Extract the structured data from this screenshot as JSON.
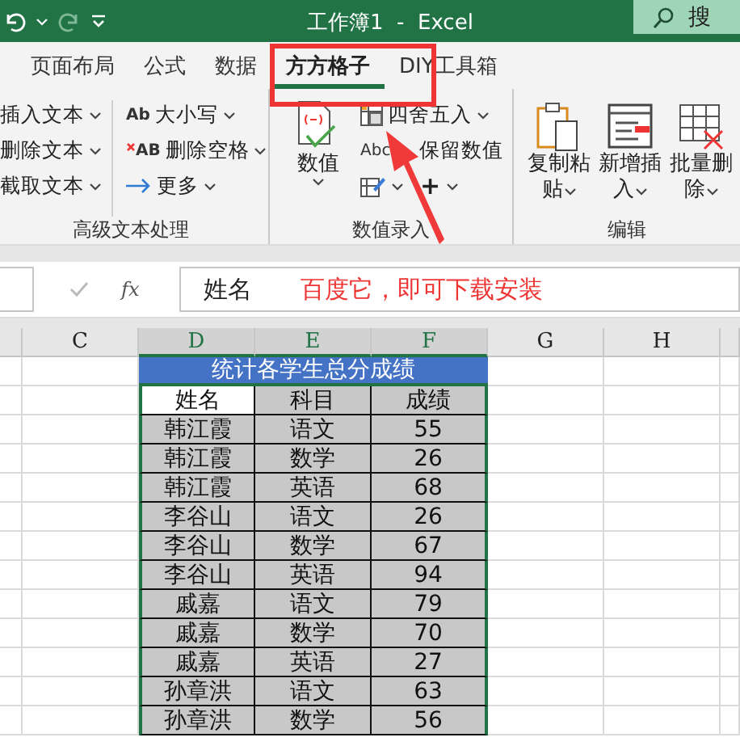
{
  "title_bar": {
    "title": "工作簿1  -  Excel",
    "search": "搜"
  },
  "tabs": [
    {
      "label": "页面布局",
      "selected": false
    },
    {
      "label": "公式",
      "selected": false
    },
    {
      "label": "数据",
      "selected": false
    },
    {
      "label": "方方格子",
      "selected": true
    },
    {
      "label": "DIY工具箱",
      "selected": false
    }
  ],
  "ribbon": {
    "groups": [
      {
        "label": "高级文本处理",
        "items": [
          {
            "label": "插入文本"
          },
          {
            "label": "删除文本"
          },
          {
            "label": "截取文本"
          }
        ],
        "items_2": [
          {
            "icon_text": "Ab",
            "label": "大小写"
          },
          {
            "icon_text": "AB",
            "label": "删除空格"
          },
          {
            "label": "更多"
          }
        ]
      },
      {
        "label": "数值录入",
        "big": {
          "label": "数值"
        },
        "items": [
          {
            "label": "四舍五入"
          },
          {
            "icon_text": "Abc",
            "label": "保留数值"
          },
          {
            "icon_text": "+"
          }
        ]
      },
      {
        "label": "编辑",
        "items": [
          {
            "label": "复制粘贴"
          },
          {
            "label": "新增插入"
          },
          {
            "label": "批量删除"
          }
        ]
      }
    ]
  },
  "formula_bar": {
    "function_symbol": "fx",
    "value": "姓名"
  },
  "annotation": {
    "note": "百度它，即可下载安装"
  },
  "sheet": {
    "columns": [
      {
        "label": "C",
        "selected": false
      },
      {
        "label": "D",
        "selected": true
      },
      {
        "label": "E",
        "selected": true
      },
      {
        "label": "F",
        "selected": true
      },
      {
        "label": "G",
        "selected": false
      },
      {
        "label": "H",
        "selected": false
      }
    ],
    "title": "统计各学生总分成绩",
    "header": {
      "D": "姓名",
      "E": "科目",
      "F": "成绩"
    },
    "rows": [
      {
        "D": "韩江霞",
        "E": "语文",
        "F": "55"
      },
      {
        "D": "韩江霞",
        "E": "数学",
        "F": "26"
      },
      {
        "D": "韩江霞",
        "E": "英语",
        "F": "68"
      },
      {
        "D": "李谷山",
        "E": "语文",
        "F": "26"
      },
      {
        "D": "李谷山",
        "E": "数学",
        "F": "67"
      },
      {
        "D": "李谷山",
        "E": "英语",
        "F": "94"
      },
      {
        "D": "戚嘉",
        "E": "语文",
        "F": "79"
      },
      {
        "D": "戚嘉",
        "E": "数学",
        "F": "70"
      },
      {
        "D": "戚嘉",
        "E": "英语",
        "F": "27"
      },
      {
        "D": "孙章洪",
        "E": "语文",
        "F": "63"
      },
      {
        "D": "孙章洪",
        "E": "数学",
        "F": "56"
      }
    ]
  }
}
